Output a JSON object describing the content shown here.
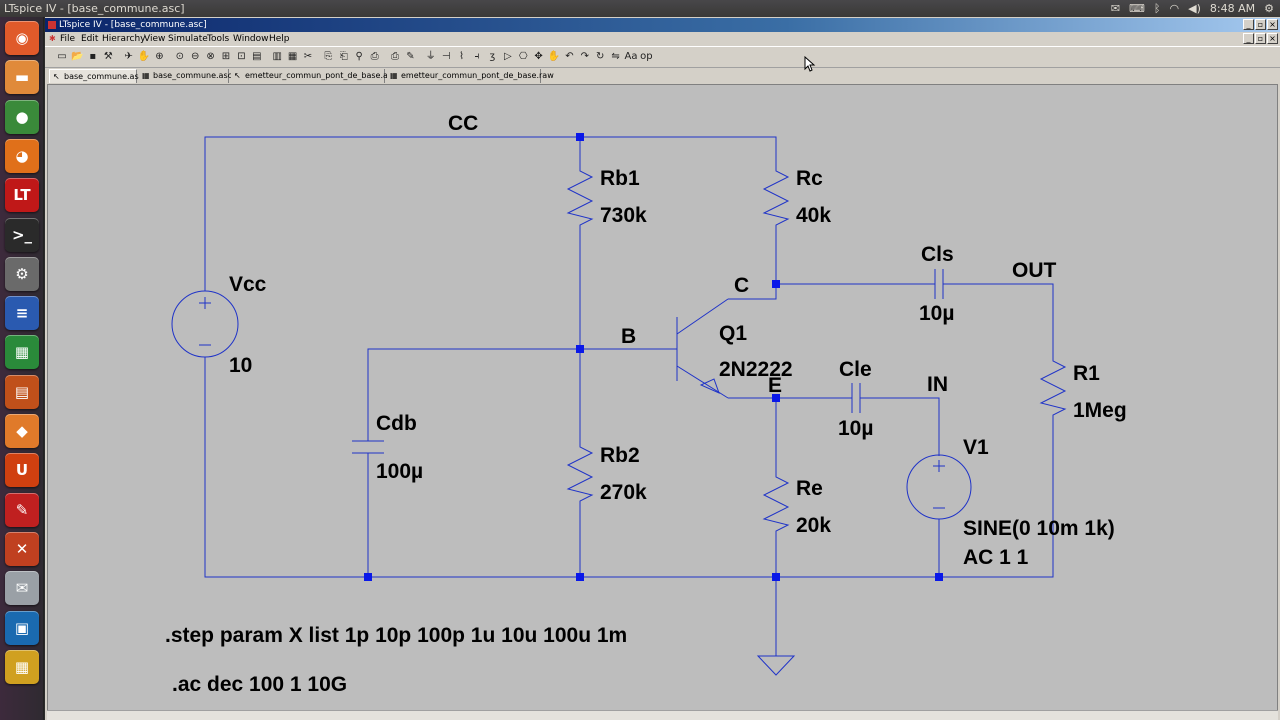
{
  "top_panel": {
    "window_title": "LTspice IV - [base_commune.asc]",
    "clock": "8:48 AM"
  },
  "launcher": {
    "items": [
      {
        "name": "ubuntu-dash",
        "glyph": "◉",
        "bg": "#e05a2a"
      },
      {
        "name": "files",
        "glyph": "▬",
        "bg": "#e08a3a"
      },
      {
        "name": "chrome",
        "glyph": "●",
        "bg": "#3a8a3a"
      },
      {
        "name": "firefox",
        "glyph": "◕",
        "bg": "#e0701a"
      },
      {
        "name": "ltspice",
        "glyph": "LT",
        "bg": "#c01818"
      },
      {
        "name": "terminal",
        "glyph": ">_",
        "bg": "#2a2a2a"
      },
      {
        "name": "settings",
        "glyph": "⚙",
        "bg": "#6a6a6a"
      },
      {
        "name": "writer",
        "glyph": "≡",
        "bg": "#2a5ab0"
      },
      {
        "name": "calc",
        "glyph": "▦",
        "bg": "#2a8a3a"
      },
      {
        "name": "impress",
        "glyph": "▤",
        "bg": "#c0501a"
      },
      {
        "name": "software-center",
        "glyph": "◆",
        "bg": "#e07a2a"
      },
      {
        "name": "ubuntu-one",
        "glyph": "U",
        "bg": "#d04010"
      },
      {
        "name": "system-tools",
        "glyph": "✎",
        "bg": "#c02020"
      },
      {
        "name": "chat",
        "glyph": "✕",
        "bg": "#c04020"
      },
      {
        "name": "mail",
        "glyph": "✉",
        "bg": "#9aa0a6"
      },
      {
        "name": "remote-desktop",
        "glyph": "▣",
        "bg": "#1a6ab0"
      },
      {
        "name": "workspaces",
        "glyph": "▦",
        "bg": "#d0a020"
      }
    ]
  },
  "window": {
    "title": "LTspice IV - [base_commune.asc]"
  },
  "menu": {
    "items": [
      "File",
      "Edit",
      "Hierarchy",
      "View",
      "Simulate",
      "Tools",
      "Window",
      "Help"
    ]
  },
  "toolbar": {
    "buttons": [
      {
        "name": "new-schematic",
        "glyph": "▭"
      },
      {
        "name": "open",
        "glyph": "📂"
      },
      {
        "name": "save",
        "glyph": "▪"
      },
      {
        "name": "control-panel",
        "glyph": "⚒"
      },
      {
        "name": "run",
        "glyph": "✈"
      },
      {
        "name": "halt",
        "glyph": "✋"
      },
      {
        "name": "zoom-in",
        "glyph": "⊕"
      },
      {
        "name": "pan",
        "glyph": "⊙"
      },
      {
        "name": "zoom-out",
        "glyph": "⊖"
      },
      {
        "name": "zoom-cancel",
        "glyph": "⊗"
      },
      {
        "name": "autorange",
        "glyph": "⊞"
      },
      {
        "name": "ghost-grid",
        "glyph": "⊡"
      },
      {
        "name": "tile-horizontal",
        "glyph": "▤"
      },
      {
        "name": "cascade",
        "glyph": "▥"
      },
      {
        "name": "close-window",
        "glyph": "▦"
      },
      {
        "name": "cut",
        "glyph": "✂"
      },
      {
        "name": "copy",
        "glyph": "⎘"
      },
      {
        "name": "paste",
        "glyph": "⎗"
      },
      {
        "name": "find",
        "glyph": "⚲"
      },
      {
        "name": "print-setup",
        "glyph": "⎙"
      },
      {
        "name": "print",
        "glyph": "⎙"
      },
      {
        "name": "draw-wire",
        "glyph": "✎"
      },
      {
        "name": "ground",
        "glyph": "⏚"
      },
      {
        "name": "label-net",
        "glyph": "⊣"
      },
      {
        "name": "resistor",
        "glyph": "⌇"
      },
      {
        "name": "capacitor",
        "glyph": "⫞"
      },
      {
        "name": "inductor",
        "glyph": "ʒ"
      },
      {
        "name": "diode",
        "glyph": "▷"
      },
      {
        "name": "component",
        "glyph": "⎔"
      },
      {
        "name": "move",
        "glyph": "✥"
      },
      {
        "name": "drag",
        "glyph": "✋"
      },
      {
        "name": "undo",
        "glyph": "↶"
      },
      {
        "name": "redo",
        "glyph": "↷"
      },
      {
        "name": "rotate",
        "glyph": "↻"
      },
      {
        "name": "mirror",
        "glyph": "⇋"
      },
      {
        "name": "text",
        "glyph": "Aa"
      },
      {
        "name": "spice-directive",
        "glyph": "op"
      }
    ]
  },
  "tabs": [
    {
      "label": "base_commune.asc",
      "active": true
    },
    {
      "label": "base_commune.asc",
      "active": false
    },
    {
      "label": "emetteur_commun_pont_de_base.asc",
      "active": false
    },
    {
      "label": "emetteur_commun_pont_de_base.raw",
      "active": false
    }
  ],
  "schematic": {
    "net_labels": {
      "cc": "CC",
      "b": "B",
      "c": "C",
      "e": "E",
      "out": "OUT",
      "in": "IN"
    },
    "components": {
      "vcc": {
        "name": "Vcc",
        "value": "10"
      },
      "rb1": {
        "name": "Rb1",
        "value": "730k"
      },
      "rc": {
        "name": "Rc",
        "value": "40k"
      },
      "cls": {
        "name": "Cls",
        "value": "10µ"
      },
      "q1": {
        "name": "Q1",
        "value": "2N2222"
      },
      "cle": {
        "name": "Cle",
        "value": "10µ"
      },
      "r1": {
        "name": "R1",
        "value": "1Meg"
      },
      "cdb": {
        "name": "Cdb",
        "value": "100µ"
      },
      "rb2": {
        "name": "Rb2",
        "value": "270k"
      },
      "re": {
        "name": "Re",
        "value": "20k"
      },
      "v1": {
        "name": "V1",
        "value": "SINE(0 10m 1k)",
        "value2": "AC 1 1"
      }
    },
    "directives": {
      "step": ".step param X list 1p 10p 100p 1u 10u 100u 1m",
      "ac": ".ac dec 100 1 10G"
    }
  },
  "colors": {
    "wire": "#1f33c8",
    "junction": "#0a18e8",
    "canvas_bg": "#bdbdbd"
  }
}
